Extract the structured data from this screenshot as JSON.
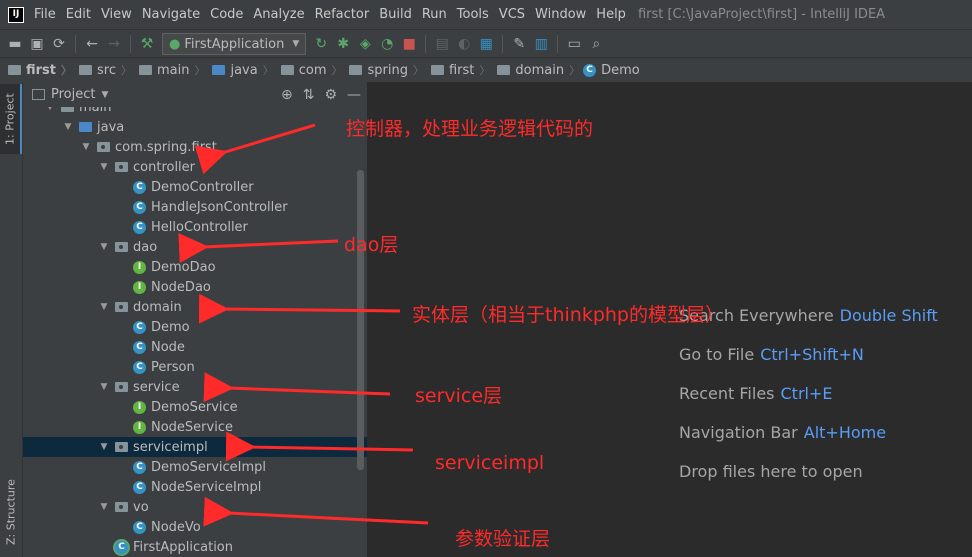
{
  "menubar": {
    "items": [
      "File",
      "Edit",
      "View",
      "Navigate",
      "Code",
      "Analyze",
      "Refactor",
      "Build",
      "Run",
      "Tools",
      "VCS",
      "Window",
      "Help"
    ],
    "window_title": "first [C:\\JavaProject\\first] - IntelliJ IDEA"
  },
  "toolbar": {
    "run_config": "FirstApplication"
  },
  "breadcrumb": [
    "first",
    "src",
    "main",
    "java",
    "com",
    "spring",
    "first",
    "domain",
    "Demo"
  ],
  "side_tabs": {
    "project": "1: Project",
    "structure": "Z: Structure"
  },
  "project_panel": {
    "title": "Project"
  },
  "tree": [
    {
      "label": "main",
      "depth": 1,
      "type": "folder",
      "expanded": true
    },
    {
      "label": "java",
      "depth": 2,
      "type": "src",
      "expanded": true
    },
    {
      "label": "com.spring.first",
      "depth": 3,
      "type": "package",
      "expanded": true
    },
    {
      "label": "controller",
      "depth": 4,
      "type": "package",
      "expanded": true
    },
    {
      "label": "DemoController",
      "depth": 5,
      "type": "class"
    },
    {
      "label": "HandleJsonController",
      "depth": 5,
      "type": "class"
    },
    {
      "label": "HelloController",
      "depth": 5,
      "type": "class"
    },
    {
      "label": "dao",
      "depth": 4,
      "type": "package",
      "expanded": true
    },
    {
      "label": "DemoDao",
      "depth": 5,
      "type": "interface"
    },
    {
      "label": "NodeDao",
      "depth": 5,
      "type": "interface"
    },
    {
      "label": "domain",
      "depth": 4,
      "type": "package",
      "expanded": true
    },
    {
      "label": "Demo",
      "depth": 5,
      "type": "class"
    },
    {
      "label": "Node",
      "depth": 5,
      "type": "class"
    },
    {
      "label": "Person",
      "depth": 5,
      "type": "class"
    },
    {
      "label": "service",
      "depth": 4,
      "type": "package",
      "expanded": true
    },
    {
      "label": "DemoService",
      "depth": 5,
      "type": "interface"
    },
    {
      "label": "NodeService",
      "depth": 5,
      "type": "interface"
    },
    {
      "label": "serviceimpl",
      "depth": 4,
      "type": "package",
      "expanded": true,
      "selected": true
    },
    {
      "label": "DemoServiceImpl",
      "depth": 5,
      "type": "class"
    },
    {
      "label": "NodeServiceImpl",
      "depth": 5,
      "type": "class"
    },
    {
      "label": "vo",
      "depth": 4,
      "type": "package",
      "expanded": true
    },
    {
      "label": "NodeVo",
      "depth": 5,
      "type": "class"
    },
    {
      "label": "FirstApplication",
      "depth": 4,
      "type": "app"
    }
  ],
  "editor_hints": [
    {
      "label": "Search Everywhere",
      "key": "Double Shift"
    },
    {
      "label": "Go to File",
      "key": "Ctrl+Shift+N"
    },
    {
      "label": "Recent Files",
      "key": "Ctrl+E"
    },
    {
      "label": "Navigation Bar",
      "key": "Alt+Home"
    },
    {
      "label": "Drop files here to open",
      "key": ""
    }
  ],
  "annotations": {
    "controller": "控制器，处理业务逻辑代码的",
    "dao": "dao层",
    "domain": "实体层（相当于thinkphp的模型层）",
    "service": "service层",
    "serviceimpl": "serviceimpl",
    "vo": "参数验证层"
  },
  "colors": {
    "annotation": "#ff2a2a",
    "accent": "#589df6",
    "selection": "#0d293e"
  }
}
